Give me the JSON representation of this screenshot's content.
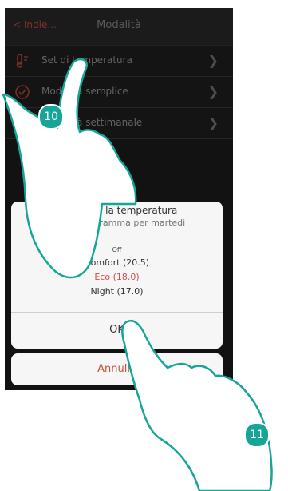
{
  "navbar": {
    "back_label": "< Indie...",
    "title": "Modalità"
  },
  "menu": [
    {
      "label": "Set di temperatura",
      "icon": "thermostat-icon"
    },
    {
      "label": "Modalità semplice",
      "icon": "check-circle-icon"
    },
    {
      "label": "Modalità settimanale",
      "icon": "calendar-icon"
    }
  ],
  "dialog": {
    "title": "Seleziona la temperatura",
    "subtitle": "Nuovo programma per martedì",
    "options": [
      "Off",
      "Comfort (20.5)",
      "Eco (18.0)",
      "Night (17.0)"
    ],
    "selected_index": 2,
    "ok_label": "OK"
  },
  "cancel_label": "Annulla",
  "steps": [
    "10",
    "11"
  ],
  "colors": {
    "accent": "#c24a3d",
    "teal": "#17a597",
    "selected": "#d84a4a"
  }
}
